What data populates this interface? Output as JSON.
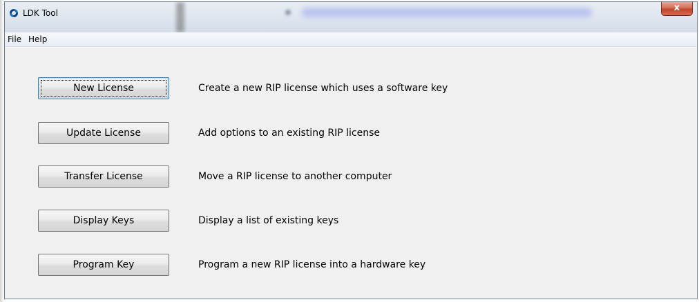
{
  "window": {
    "title": "LDK Tool",
    "close_label": "x"
  },
  "menu": {
    "items": [
      "File",
      "Help"
    ]
  },
  "actions": [
    {
      "label": "New License",
      "description": "Create a new RIP license which uses a software key"
    },
    {
      "label": "Update License",
      "description": "Add options to an existing RIP license"
    },
    {
      "label": "Transfer License",
      "description": "Move a RIP license to another computer"
    },
    {
      "label": "Display Keys",
      "description": "Display a list of existing keys"
    },
    {
      "label": "Program Key",
      "description": "Program a new RIP license into a hardware key"
    }
  ],
  "icons": {
    "app": "ldk-app-icon",
    "close": "close-icon"
  },
  "colors": {
    "close_button": "#c4432b",
    "window_bg": "#f0f0f0",
    "title_bar": "#dfe6ef"
  }
}
